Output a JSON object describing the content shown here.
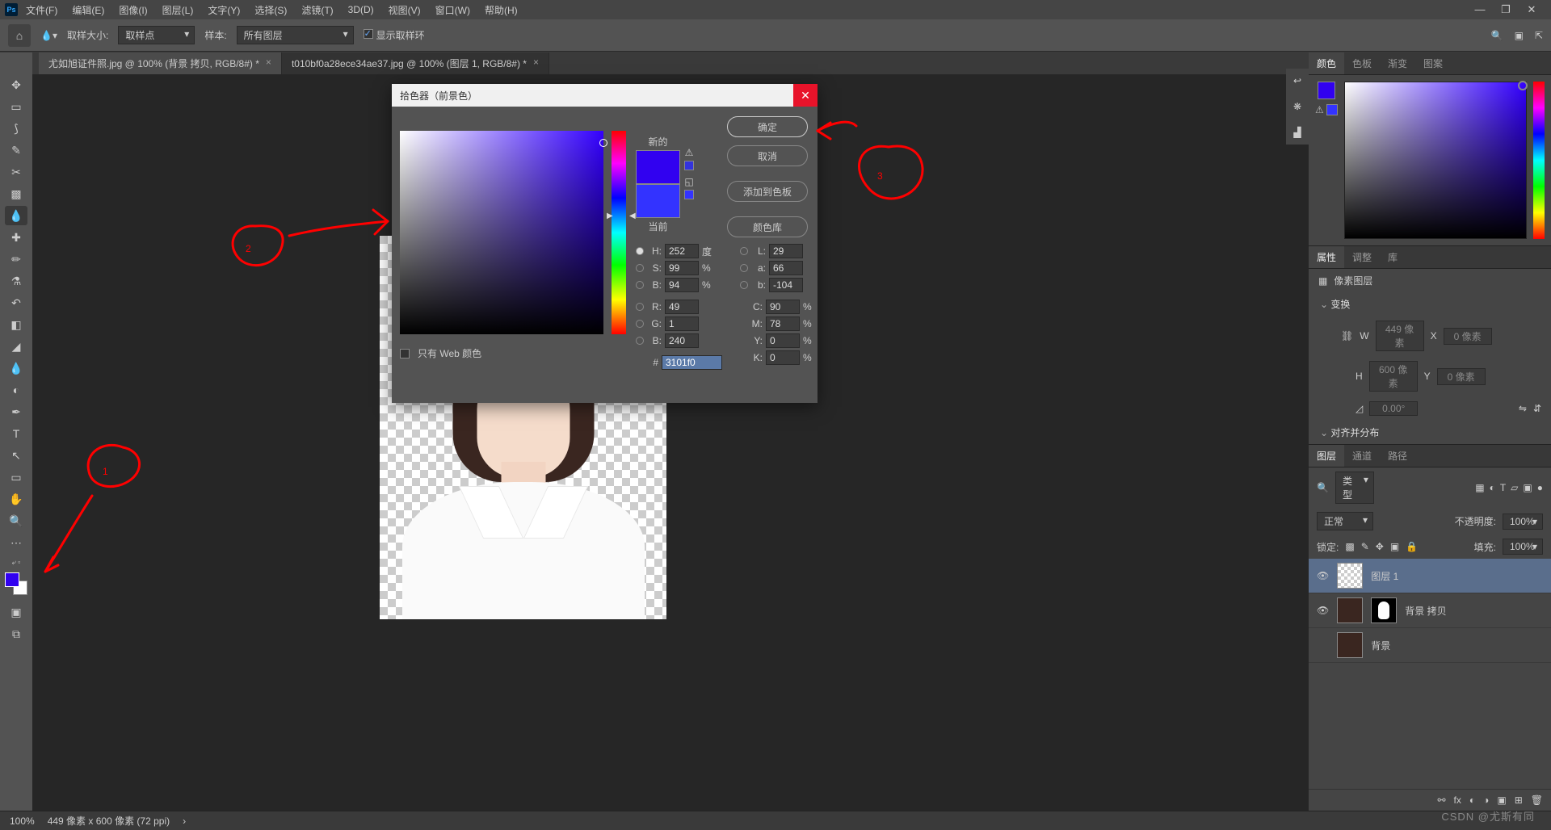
{
  "menu": [
    "文件(F)",
    "编辑(E)",
    "图像(I)",
    "图层(L)",
    "文字(Y)",
    "选择(S)",
    "滤镜(T)",
    "3D(D)",
    "视图(V)",
    "窗口(W)",
    "帮助(H)"
  ],
  "opt": {
    "sample_size_label": "取样大小:",
    "sample_size_value": "取样点",
    "sample_label": "样本:",
    "sample_value": "所有图层",
    "show_ring": "显示取样环"
  },
  "tabs": [
    {
      "label": "尤如旭证件照.jpg @ 100% (背景 拷贝, RGB/8#) *"
    },
    {
      "label": "t010bf0a28ece34ae37.jpg @ 100% (图层 1, RGB/8#) *"
    }
  ],
  "status": {
    "zoom": "100%",
    "info": "449 像素 x 600 像素 (72 ppi)"
  },
  "rp": {
    "tabs_color": [
      "颜色",
      "色板",
      "渐变",
      "图案"
    ],
    "tabs_props": [
      "属性",
      "调整",
      "库"
    ],
    "props_type": "像素图层",
    "transform": "变换",
    "w_label": "W",
    "w_val": "449 像素",
    "x_label": "X",
    "x_val": "0 像素",
    "h_label": "H",
    "h_val": "600 像素",
    "y_label": "Y",
    "y_val": "0 像素",
    "angle": "0.00°",
    "align": "对齐并分布",
    "tabs_layers": [
      "图层",
      "通道",
      "路径"
    ],
    "layer_search": "类型",
    "blend": "正常",
    "opacity_l": "不透明度:",
    "opacity_v": "100%",
    "lock_l": "锁定:",
    "fill_l": "填充:",
    "fill_v": "100%",
    "layers": [
      {
        "name": "图层 1"
      },
      {
        "name": "背景 拷贝"
      },
      {
        "name": "背景"
      }
    ]
  },
  "picker": {
    "title": "拾色器（前景色）",
    "btn_ok": "确定",
    "btn_cancel": "取消",
    "btn_add": "添加到色板",
    "btn_lib": "颜色库",
    "new": "新的",
    "current": "当前",
    "web_only": "只有 Web 颜色",
    "H": "252",
    "S": "99",
    "Bv": "94",
    "L": "29",
    "a": "66",
    "b": "-104",
    "R": "49",
    "G": "1",
    "Bb": "240",
    "C": "90",
    "M": "78",
    "Yv": "0",
    "K": "0",
    "hex": "3101f0",
    "deg": "度",
    "pct": "%"
  },
  "fg_color": "#3101f0",
  "bg_color": "#ffffff",
  "watermark": "CSDN @尤斯有同",
  "chart_data": null
}
